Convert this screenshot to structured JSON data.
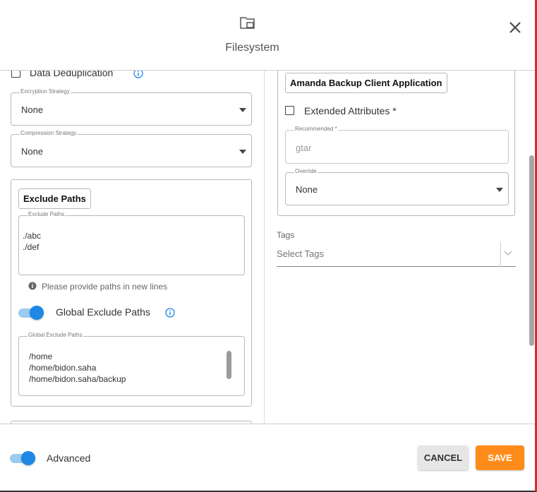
{
  "dialog": {
    "title": "Filesystem",
    "header_icon": "folder-icon",
    "close_icon": "close-icon"
  },
  "left": {
    "dedup_label": "Data Deduplication",
    "encryption": {
      "legend": "Encryption Strategy",
      "value": "None"
    },
    "compression": {
      "legend": "Compression Strategy",
      "value": "None"
    },
    "exclude": {
      "button_label": "Exclude Paths",
      "legend": "Exclude Paths",
      "paths": "./abc\n./def",
      "hint": "Please provide paths in new lines",
      "global_toggle_label": "Global Exclude Paths",
      "global_toggle_on": true,
      "global_legend": "Global Exclude Paths",
      "global_paths": "/home\n/home/bidon.saha\n/home/bidon.saha/backup"
    }
  },
  "right": {
    "app_button_label": "Amanda Backup Client Application",
    "extended_label": "Extended Attributes *",
    "recommended": {
      "legend": "Recommended *",
      "value": "gtar"
    },
    "override": {
      "legend": "Override",
      "value": "None"
    },
    "tags": {
      "label": "Tags",
      "placeholder": "Select Tags"
    }
  },
  "footer": {
    "advanced_label": "Advanced",
    "advanced_on": true,
    "cancel_label": "CANCEL",
    "save_label": "SAVE"
  },
  "colors": {
    "accent": "#1e88e5",
    "save": "#ff8c1a",
    "frame_right": "#d0312d"
  }
}
